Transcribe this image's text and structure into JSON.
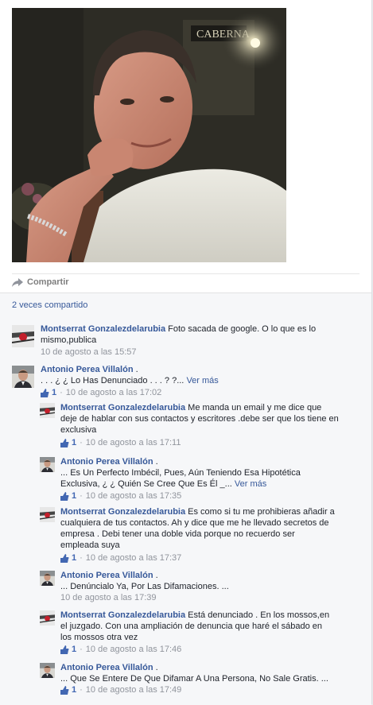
{
  "post": {
    "share_label": "Compartir",
    "shared_count": "2 veces compartido"
  },
  "comments": [
    {
      "author": "Montserrat Gonzalezdelarubia",
      "text": "Foto sacada de google. O lo que es lo mismo,publica",
      "likes": null,
      "date": "10 de agosto a las 15:57",
      "avatar": "flower-avatar"
    },
    {
      "author": "Antonio Perea Villalón",
      "text": ". . . ¿ ¿ Lo Has Denunciado . . . ? ?...",
      "more": "Ver más",
      "likes": "1",
      "date": "10 de agosto a las 17:02",
      "avatar": "man-avatar"
    },
    {
      "author": "Montserrat Gonzalezdelarubia",
      "text": "Me manda un email y me dice que deje de hablar con sus contactos y escritores .debe ser que los tiene en exclusiva",
      "likes": "1",
      "date": "10 de agosto a las 17:11",
      "avatar": "flower-avatar"
    },
    {
      "author": "Antonio Perea Villalón",
      "text": "... Es Un Perfecto Imbécil, Pues, Aún Teniendo Esa Hipotética Exclusiva, ¿ ¿ Quién Se Cree Que Es Él _...",
      "more": "Ver más",
      "likes": "1",
      "date": "10 de agosto a las 17:35",
      "avatar": "man-avatar"
    },
    {
      "author": "Montserrat Gonzalezdelarubia",
      "text": "Es como si tu me prohibieras añadir a cualquiera de tus contactos. Ah y dice que me he llevado secretos de empresa . Debi tener una doble vida porque no recuerdo ser empleada suya",
      "likes": "1",
      "date": "10 de agosto a las 17:37",
      "avatar": "flower-avatar"
    },
    {
      "author": "Antonio Perea Villalón",
      "text": "... Denúncialo Ya, Por Las Difamaciones. ...",
      "likes": null,
      "date": "10 de agosto a las 17:39",
      "avatar": "man-avatar"
    },
    {
      "author": "Montserrat Gonzalezdelarubia",
      "text": "Está denunciado . En los mossos,en el juzgado. Con una ampliación de denuncia que haré el sábado en los mossos otra vez",
      "likes": "1",
      "date": "10 de agosto a las 17:46",
      "avatar": "flower-avatar"
    },
    {
      "author": "Antonio Perea Villalón",
      "text": "... Que Se Entere De Que Difamar A Una Persona, No Sale Gratis. ...",
      "likes": "1",
      "date": "10 de agosto a las 17:49",
      "avatar": "man-avatar"
    }
  ],
  "colors": {
    "link": "#365899",
    "meta": "#90949c",
    "like": "#4267b2",
    "comments_bg": "#f6f7f9"
  }
}
